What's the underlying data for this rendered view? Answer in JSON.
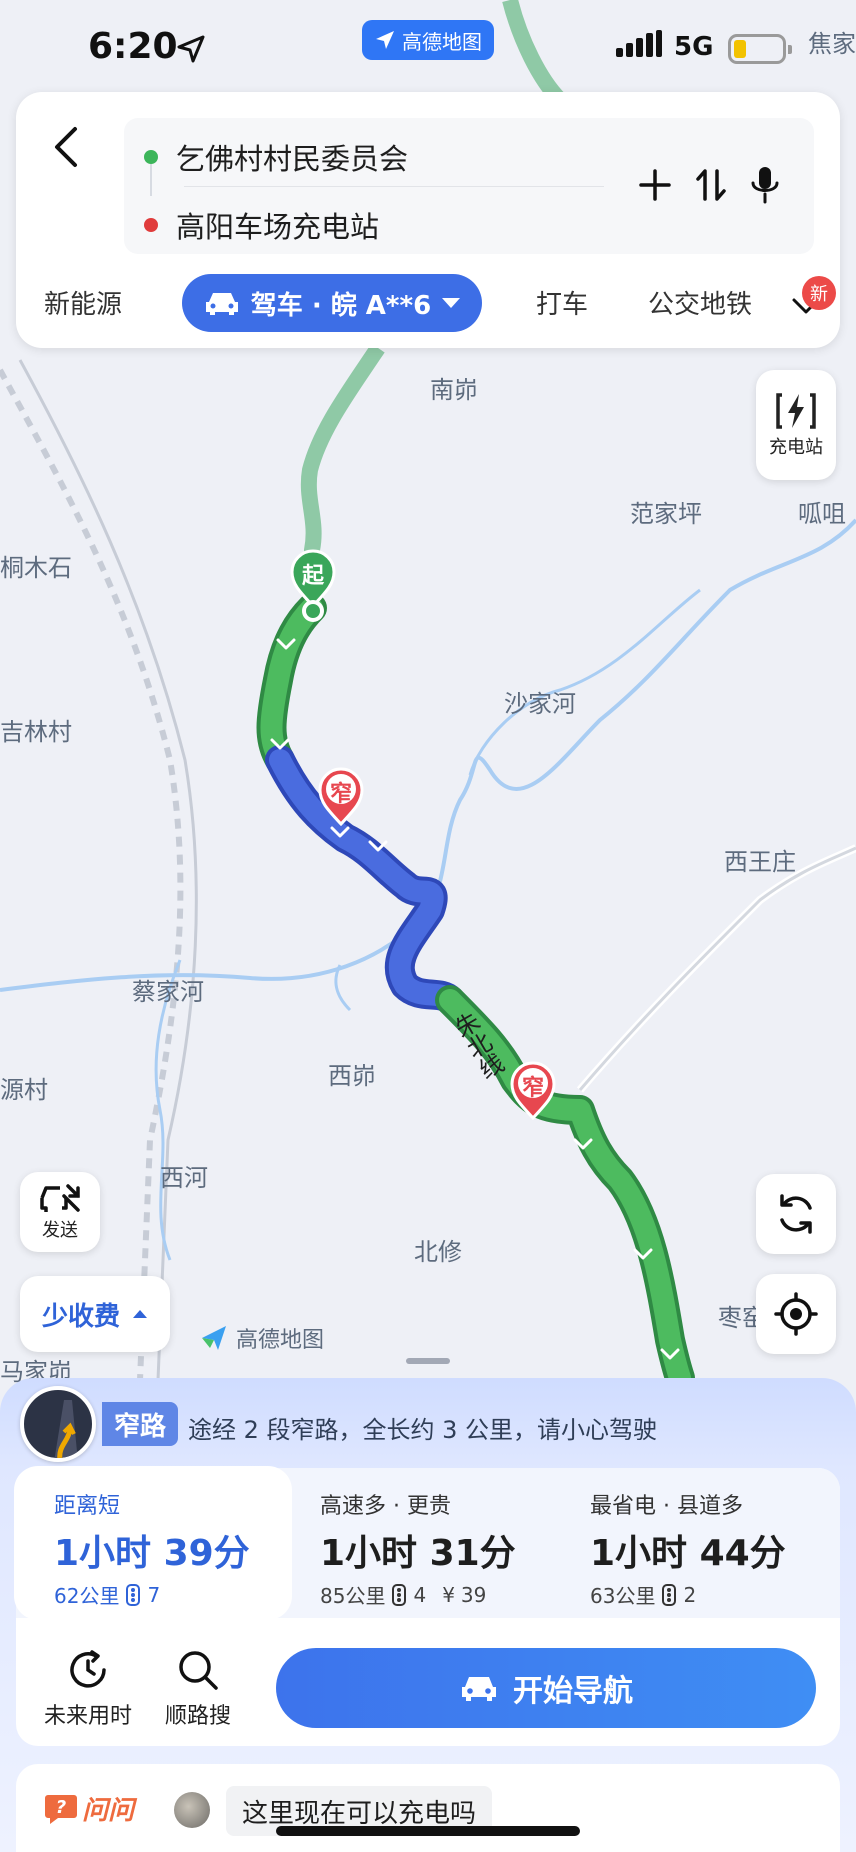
{
  "status_bar": {
    "time": "6:20",
    "app_badge": "高德地图",
    "network": "5G",
    "edge_place": "焦家"
  },
  "search": {
    "origin": "乞佛村村民委员会",
    "destination": "高阳车场充电站",
    "origin_color": "#3cb55a",
    "destination_color": "#e03c3c"
  },
  "modes": {
    "items": [
      "新能源",
      "打车",
      "公交地铁"
    ],
    "active": "驾车 · 皖 A**6",
    "new_badge": "新"
  },
  "map": {
    "places": [
      "南峁",
      "范家坪",
      "呱咀",
      "桐木石",
      "沙家河",
      "吉林村",
      "西王庄",
      "蔡家河",
      "西峁",
      "源村",
      "西河",
      "北修",
      "枣窑",
      "马家峁"
    ],
    "road_name": "朱北线",
    "start_marker": "起",
    "narrow_marker": "窄",
    "charging_button": "充电站",
    "send_button": "发送",
    "toll_option": "少收费",
    "watermark": "高德地图",
    "route_color": "#4dbb5f",
    "narrow_color": "#4a6cdf"
  },
  "alert": {
    "tag": "窄路",
    "text": "途经 2 段窄路，全长约 3 公里，请小心驾驶"
  },
  "routes": [
    {
      "tag": "距离短",
      "time": "1小时 39分",
      "distance": "62公里",
      "lights": "7",
      "toll": ""
    },
    {
      "tag": "高速多 · 更贵",
      "time": "1小时 31分",
      "distance": "85公里",
      "lights": "4",
      "toll": "39"
    },
    {
      "tag": "最省电 · 县道多",
      "time": "1小时 44分",
      "distance": "63公里",
      "lights": "2",
      "toll": ""
    }
  ],
  "actions": {
    "future": "未来用时",
    "along": "顺路搜",
    "start_nav": "开始导航"
  },
  "ask": {
    "logo": "问问",
    "question": "这里现在可以充电吗"
  },
  "colors": {
    "accent": "#3d6ee6",
    "alert_blue": "#5f86e6"
  }
}
